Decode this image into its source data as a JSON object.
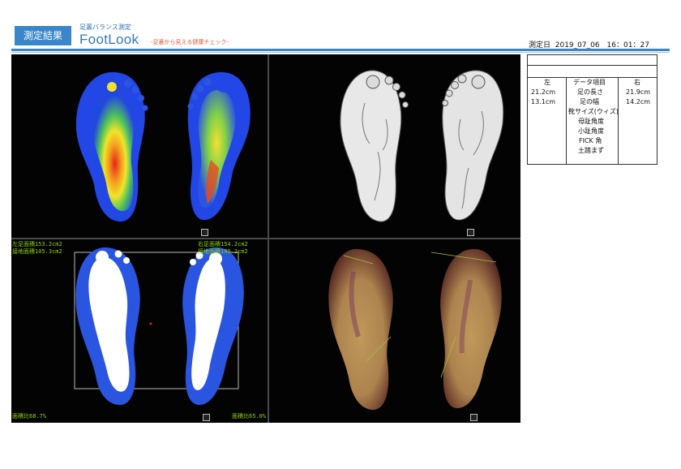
{
  "header": {
    "badge": "測定結果",
    "subtitle": "足裏バランス測定",
    "logo": "FootLook",
    "tagline": "-足裏から見える健康チェック-",
    "date_label": "測定日",
    "date_value": "2019_07_06　16：01：27"
  },
  "panels": {
    "outline_overlay": {
      "left_area": "左足面積153.2cm2",
      "left_contact": "接地面積105.3cm2",
      "right_area": "右足面積154.2cm2",
      "right_contact": "接地面積100.2cm2",
      "left_ratio": "面積比68.7%",
      "right_ratio": "面積比65.0%"
    }
  },
  "data_table": {
    "left_header": "左",
    "item_header": "データ項目",
    "right_header": "右",
    "rows": [
      {
        "label": "足の長さ",
        "left": "21.2cm",
        "right": "21.9cm"
      },
      {
        "label": "足の幅",
        "left": "13.1cm",
        "right": "14.2cm"
      },
      {
        "label": "靴サイズ(ウィズ)",
        "left": "",
        "right": ""
      },
      {
        "label": "母趾角度",
        "left": "",
        "right": ""
      },
      {
        "label": "小趾角度",
        "left": "",
        "right": ""
      },
      {
        "label": "FICK 角",
        "left": "",
        "right": ""
      },
      {
        "label": "土踏まず",
        "left": "",
        "right": ""
      }
    ]
  },
  "colors": {
    "accent": "#3b86c8",
    "tagline": "#e15a3a",
    "overlay_text": "#8fd400",
    "footprint_blue": "#2a55e0"
  }
}
